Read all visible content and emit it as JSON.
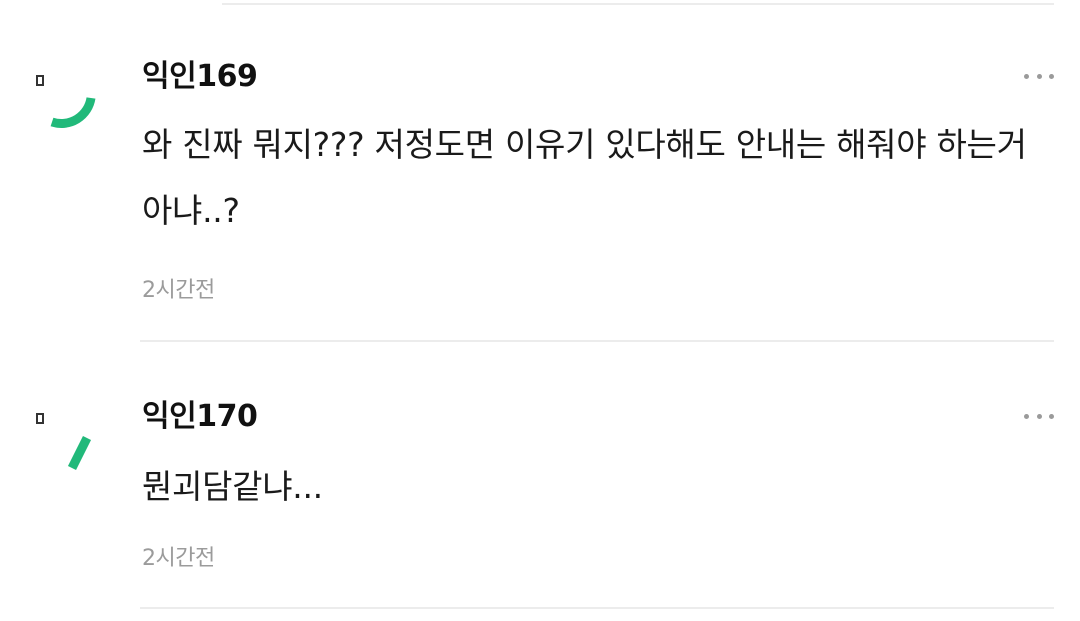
{
  "comments": [
    {
      "author": "익인169",
      "text": "와 진짜 뭐지??? 저정도면 이유기 있다해도 안내는 해줘야 하는거아냐..?",
      "time": "2시간전",
      "avatar_color": "#21b97a",
      "avatar_icon": "loading-arc-icon"
    },
    {
      "author": "익인170",
      "text": "뭔괴담같냐...",
      "time": "2시간전",
      "avatar_color": "#21b97a",
      "avatar_icon": "loading-dash-icon"
    }
  ],
  "colors": {
    "text": "#111111",
    "muted": "#9b9b9b",
    "divider": "#ececec",
    "accent": "#21b97a"
  }
}
